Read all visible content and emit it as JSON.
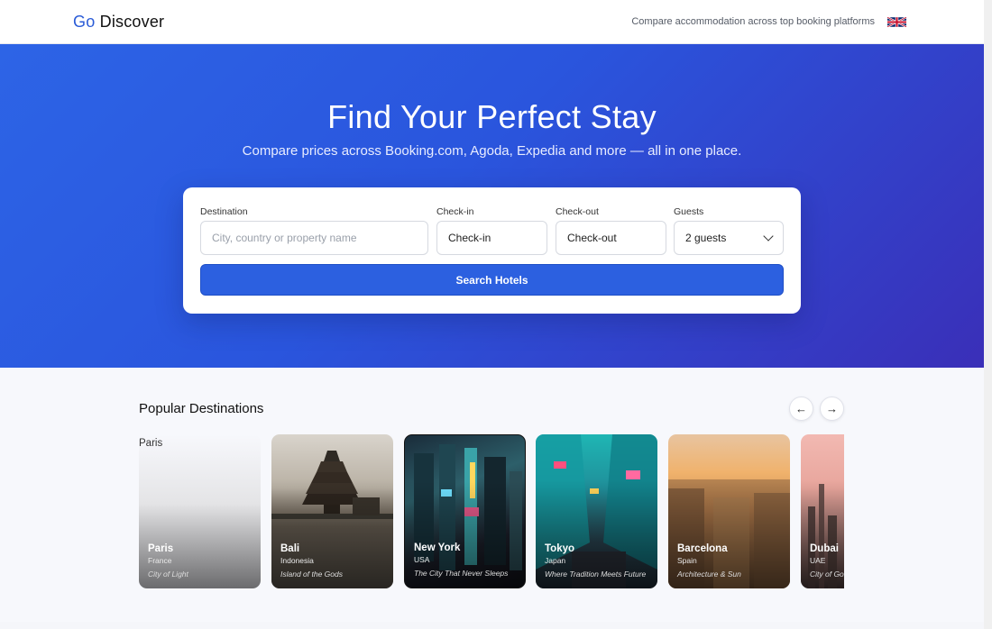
{
  "header": {
    "logo_go": "Go",
    "logo_rest": "Discover",
    "tagline": "Compare accommodation across top booking platforms"
  },
  "hero": {
    "title": "Find Your Perfect Stay",
    "subtitle": "Compare prices across Booking.com, Agoda, Expedia and more — all in one place."
  },
  "search": {
    "destination_label": "Destination",
    "destination_placeholder": "City, country or property name",
    "checkin_label": "Check-in",
    "checkin_value": "Check-in",
    "checkout_label": "Check-out",
    "checkout_value": "Check-out",
    "guests_label": "Guests",
    "guests_value": "2 guests",
    "button": "Search Hotels"
  },
  "destinations": {
    "title": "Popular Destinations",
    "prev": "←",
    "next": "→",
    "items": [
      {
        "name": "Paris",
        "country": "France",
        "motto": "City of Light",
        "alt": "Paris"
      },
      {
        "name": "Bali",
        "country": "Indonesia",
        "motto": "Island of the Gods"
      },
      {
        "name": "New York",
        "country": "USA",
        "motto": "The City That Never Sleeps"
      },
      {
        "name": "Tokyo",
        "country": "Japan",
        "motto": "Where Tradition Meets Future"
      },
      {
        "name": "Barcelona",
        "country": "Spain",
        "motto": "Architecture & Sun"
      },
      {
        "name": "Dubai",
        "country": "UAE",
        "motto": "City of Gold"
      }
    ]
  },
  "colors": {
    "brand": "#2a5bd7",
    "button": "#2c60e0"
  }
}
